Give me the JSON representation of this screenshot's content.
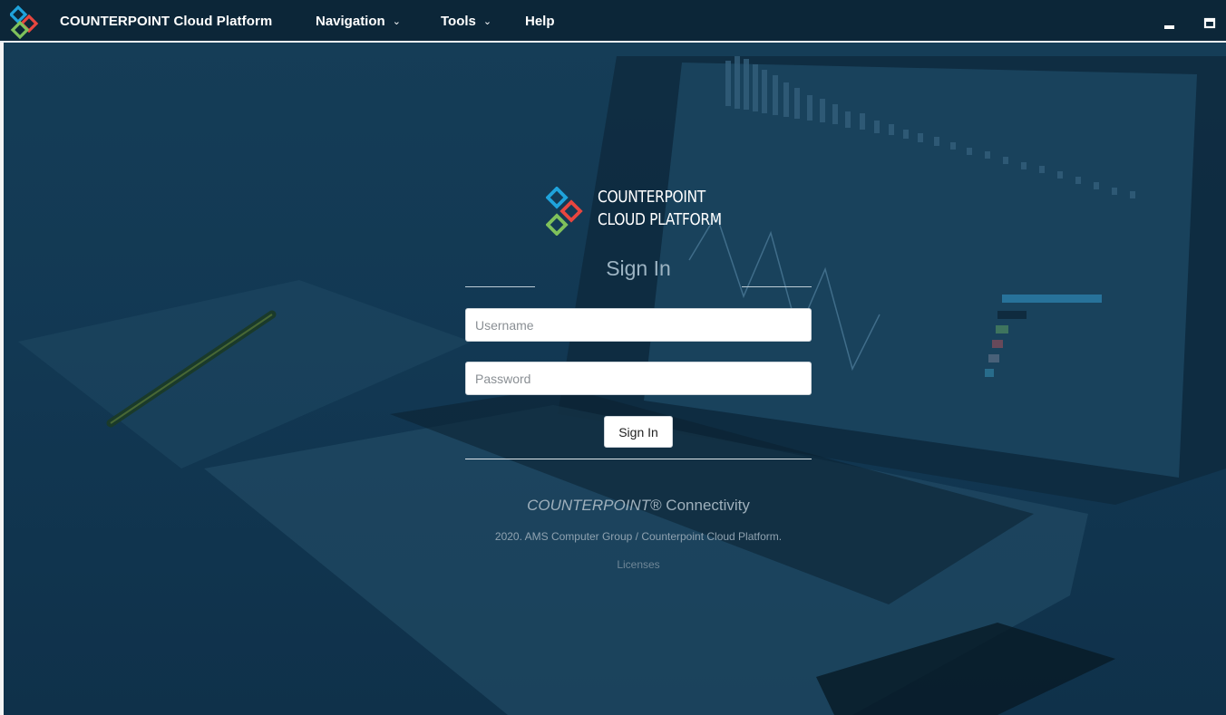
{
  "titlebar": {
    "app_title": "COUNTERPOINT Cloud Platform",
    "menu": [
      {
        "label": "Navigation",
        "has_dropdown": true
      },
      {
        "label": "Tools",
        "has_dropdown": true
      },
      {
        "label": "Help",
        "has_dropdown": false
      }
    ],
    "window_controls": [
      "minimize-icon",
      "maximize-icon"
    ]
  },
  "brand": {
    "line1": "COUNTERPOINT",
    "line2": "CLOUD PLATFORM",
    "colors": {
      "blue": "#1fa3dc",
      "red": "#e8463f",
      "green": "#7fc15b"
    }
  },
  "login": {
    "heading": "Sign In",
    "username_placeholder": "Username",
    "password_placeholder": "Password",
    "submit_label": "Sign In"
  },
  "footer": {
    "brand_name": "COUNTERPOINT",
    "brand_suffix": "® Connectivity",
    "copyright": "2020. AMS Computer Group / Counterpoint Cloud Platform.",
    "licenses_link": "Licenses"
  },
  "theme": {
    "topbar_bg": "#0c2638",
    "page_bg": "#133a54",
    "accent_muted": "#9db4c3"
  }
}
